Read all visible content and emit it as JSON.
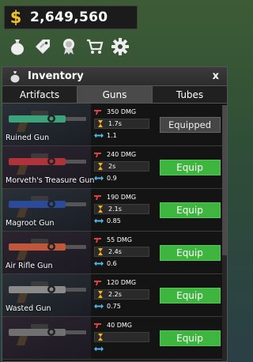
{
  "money": {
    "symbol": "$",
    "amount": "2,649,560"
  },
  "menu_icons": [
    "money-bag-icon",
    "tag-icon",
    "badge-icon",
    "cart-icon",
    "gear-icon"
  ],
  "inventory": {
    "title": "Inventory",
    "close_label": "x",
    "tabs": [
      {
        "label": "Artifacts",
        "active": false
      },
      {
        "label": "Guns",
        "active": true
      },
      {
        "label": "Tubes",
        "active": false
      }
    ],
    "guns": [
      {
        "name": "Ruined Gun",
        "dmg": "350 DMG",
        "rate": "1.7s",
        "speed": "1.1",
        "action": "Equipped",
        "color": "#3aa37a"
      },
      {
        "name": "Morveth's Treasure Gun",
        "dmg": "240 DMG",
        "rate": "2s",
        "speed": "0.9",
        "action": "Equip",
        "color": "#b0323a"
      },
      {
        "name": "Magroot Gun",
        "dmg": "190 DMG",
        "rate": "2.1s",
        "speed": "0.85",
        "action": "Equip",
        "color": "#2b4a9a"
      },
      {
        "name": "Air Rifle Gun",
        "dmg": "55 DMG",
        "rate": "2.4s",
        "speed": "0.6",
        "action": "Equip",
        "color": "#c0563a"
      },
      {
        "name": "Wasted Gun",
        "dmg": "120 DMG",
        "rate": "2.2s",
        "speed": "0.75",
        "action": "Equip",
        "color": "#8a8a8a"
      },
      {
        "name": "",
        "dmg": "40 DMG",
        "rate": "",
        "speed": "",
        "action": "Equip",
        "color": "#707070"
      }
    ]
  }
}
